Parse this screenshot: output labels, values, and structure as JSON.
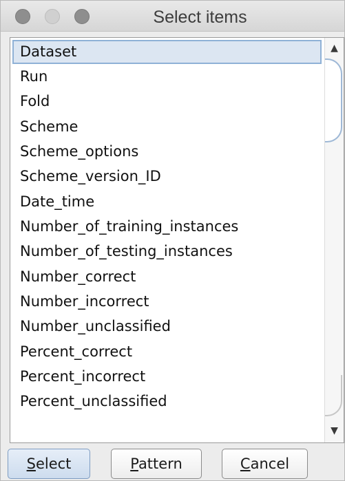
{
  "window": {
    "title": "Select items"
  },
  "list": {
    "items": [
      {
        "label": "Dataset",
        "selected": true
      },
      {
        "label": "Run",
        "selected": false
      },
      {
        "label": "Fold",
        "selected": false
      },
      {
        "label": "Scheme",
        "selected": false
      },
      {
        "label": "Scheme_options",
        "selected": false
      },
      {
        "label": "Scheme_version_ID",
        "selected": false
      },
      {
        "label": "Date_time",
        "selected": false
      },
      {
        "label": "Number_of_training_instances",
        "selected": false
      },
      {
        "label": "Number_of_testing_instances",
        "selected": false
      },
      {
        "label": "Number_correct",
        "selected": false
      },
      {
        "label": "Number_incorrect",
        "selected": false
      },
      {
        "label": "Number_unclassified",
        "selected": false
      },
      {
        "label": "Percent_correct",
        "selected": false
      },
      {
        "label": "Percent_incorrect",
        "selected": false
      },
      {
        "label": "Percent_unclassified",
        "selected": false
      }
    ]
  },
  "scrollbar": {
    "up_icon": "triangle-up",
    "down_icon": "triangle-down"
  },
  "buttons": {
    "select": {
      "mnemonic": "S",
      "rest": "elect"
    },
    "pattern": {
      "mnemonic": "P",
      "rest": "attern"
    },
    "cancel": {
      "mnemonic": "C",
      "rest": "ancel"
    }
  },
  "colors": {
    "selection_fill": "#dce6f2",
    "selection_border": "#8fb1d6"
  }
}
